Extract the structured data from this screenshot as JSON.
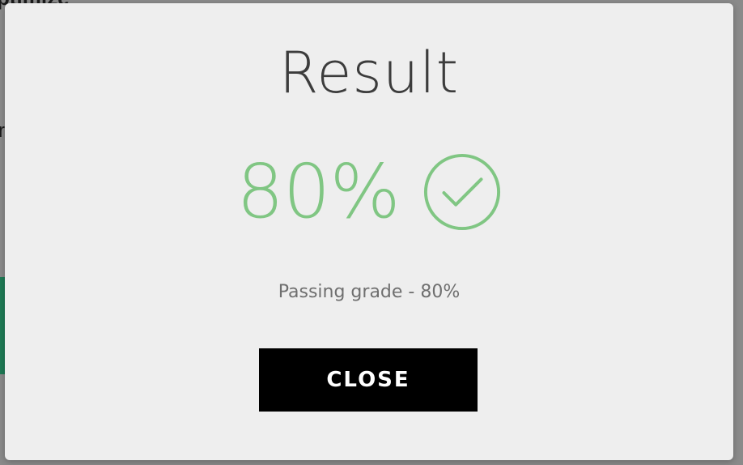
{
  "background": {
    "top_text": "ptimize",
    "mid_text": "r"
  },
  "modal": {
    "title": "Result",
    "score": "80%",
    "score_color": "#80c683",
    "status_icon": "checkmark-circle-icon",
    "passing_text": "Passing grade - 80%",
    "close_label": "CLOSE"
  }
}
